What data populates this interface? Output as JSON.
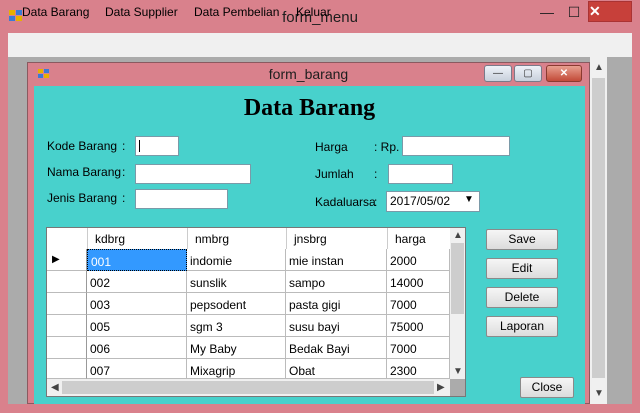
{
  "window": {
    "title": "form_menu",
    "min_glyph": "—",
    "max_glyph": "☐",
    "close_glyph": "✕"
  },
  "menu": {
    "items": [
      "Data Barang",
      "Data Supplier",
      "Data Pembelian",
      "Keluar"
    ]
  },
  "child": {
    "title": "form_barang",
    "min_glyph": "—",
    "max_glyph": "▢",
    "close_glyph": "✕"
  },
  "form": {
    "heading": "Data Barang",
    "kode_label": "Kode Barang",
    "nama_label": "Nama Barang",
    "jenis_label": "Jenis Barang",
    "harga_label": "Harga",
    "harga_prefix": ": Rp.",
    "jumlah_label": "Jumlah",
    "kadaluarsa_label": "Kadaluarsa",
    "colon": ":",
    "kadaluarsa_value": "2017/05/02"
  },
  "grid": {
    "columns": [
      "kdbrg",
      "nmbrg",
      "jnsbrg",
      "harga"
    ],
    "rows": [
      [
        "001",
        "indomie",
        "mie instan",
        "2000"
      ],
      [
        "002",
        "sunslik",
        "sampo",
        "14000"
      ],
      [
        "003",
        "pepsodent",
        "pasta gigi",
        "7000"
      ],
      [
        "005",
        "sgm 3",
        "susu bayi",
        "75000"
      ],
      [
        "006",
        "My Baby",
        "Bedak Bayi",
        "7000"
      ],
      [
        "007",
        "Mixagrip",
        "Obat",
        "2300"
      ]
    ],
    "current_row_glyph": "▶",
    "up_glyph": "▲",
    "down_glyph": "▼",
    "left_glyph": "◀",
    "right_glyph": "▶"
  },
  "buttons": {
    "save": "Save",
    "edit": "Edit",
    "delete": "Delete",
    "laporan": "Laporan",
    "close": "Close"
  },
  "icons": {
    "app": "app-icon",
    "combo_arrow": "chevron-down-icon"
  },
  "colors": {
    "frame": "#d9818c",
    "panel": "#48d1cc",
    "selection": "#3399ff"
  }
}
